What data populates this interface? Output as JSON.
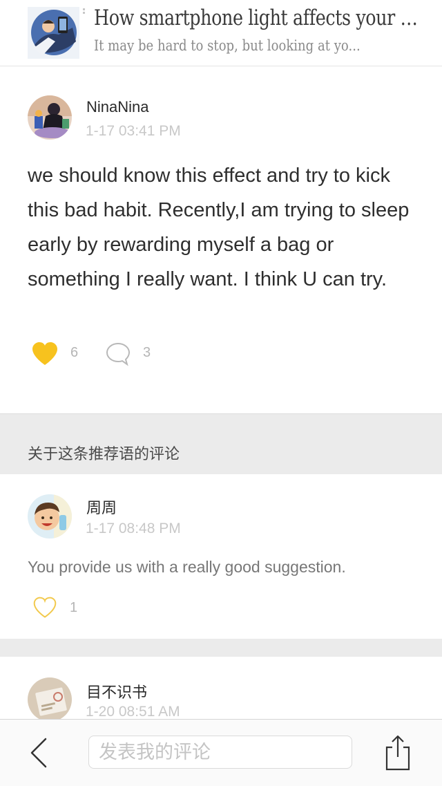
{
  "article": {
    "title": "How smartphone light affects your brai...",
    "subtitle": "It may be hard to stop, but looking at yo...",
    "thumbnail_icon": "person-holding-phone-illustration"
  },
  "main_comment": {
    "username": "NinaNina",
    "timestamp": "1-17 03:41 PM",
    "body": "we should know this effect and try to kick this bad habit. Recently,I am trying to sleep early by rewarding myself a bag or something I really want. I think U can try.",
    "likes": "6",
    "comments": "3",
    "liked": true
  },
  "section": {
    "title": "关于这条推荐语的评论"
  },
  "replies": [
    {
      "username": "周周",
      "timestamp": "1-17 08:48 PM",
      "text": "You provide us with a really good suggestion.",
      "likes": "1"
    },
    {
      "username": "目不识书",
      "timestamp": "1-20 08:51 AM"
    }
  ],
  "bottom_bar": {
    "input_placeholder": "发表我的评论"
  },
  "colors": {
    "heart_filled": "#F7C21E",
    "heart_outline": "#F2C94C",
    "muted_text": "#C8C8C8",
    "section_bg": "#EBEBEB"
  }
}
